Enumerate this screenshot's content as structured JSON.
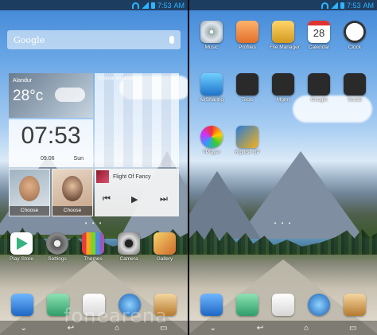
{
  "status": {
    "time": "7:53",
    "time_suffix": "AM"
  },
  "search": {
    "brand": "Google"
  },
  "weather": {
    "city": "Alandur",
    "temp": "28°c"
  },
  "clock": {
    "time": "07:53",
    "date": "09.06",
    "day": "Sun"
  },
  "album": {
    "label": "Choose an album"
  },
  "photos": [
    {
      "caption": "Choose"
    },
    {
      "caption": "Choose"
    }
  ],
  "music": {
    "song": "Flight Of Fancy"
  },
  "dock_left": [
    "Play Store",
    "Settings",
    "Themes",
    "Camera",
    "Gallery"
  ],
  "apps_right": [
    {
      "label": "Music"
    },
    {
      "label": "Profiles"
    },
    {
      "label": "File Manager"
    },
    {
      "label": "Calendar",
      "day": "28"
    },
    {
      "label": "Clock"
    },
    {
      "label": "AirSharing"
    },
    {
      "label": "Tools"
    },
    {
      "label": "Mgmt"
    },
    {
      "label": "Google"
    },
    {
      "label": "Social"
    },
    {
      "label": "TPlayer"
    },
    {
      "label": "Riptide GP"
    }
  ],
  "watermark": "fonearena",
  "colors": {
    "accent": "#2fb4ff"
  }
}
